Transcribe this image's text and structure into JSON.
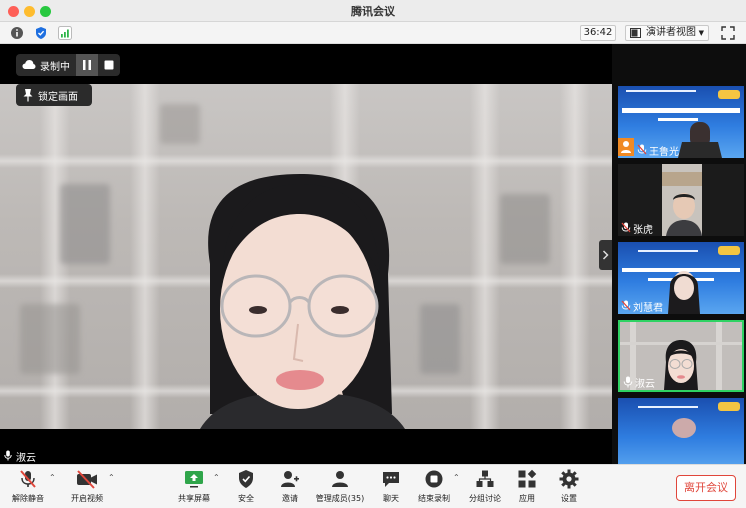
{
  "window": {
    "title": "腾讯会议"
  },
  "infobar": {
    "timer": "36:42",
    "view_mode": "演讲者视图",
    "icons": [
      "info-icon",
      "shield-icon",
      "signal-icon",
      "fullscreen-icon"
    ]
  },
  "main_video": {
    "recording_label": "录制中",
    "pin_label": "锁定画面",
    "speaker_name": "淑云"
  },
  "participants": [
    {
      "name": "王鲁光",
      "banner_title": "第五届山东省大学生创新创意设计大赛",
      "banner_sub": "线上答辩"
    },
    {
      "name": "张虎"
    },
    {
      "name": "刘慧君"
    },
    {
      "name": "淑云"
    },
    {
      "name": ""
    }
  ],
  "toolbar": {
    "unmute": "解除静音",
    "start_video": "开启视频",
    "share_screen": "共享屏幕",
    "security": "安全",
    "invite": "邀请",
    "manage_members": "管理成员(35)",
    "chat": "聊天",
    "end_recording": "结束录制",
    "breakout": "分组讨论",
    "apps": "应用",
    "settings": "设置",
    "leave": "离开会议"
  },
  "colors": {
    "active_border": "#2fd263",
    "leave": "#e0463b",
    "muted": "#e0463b"
  }
}
